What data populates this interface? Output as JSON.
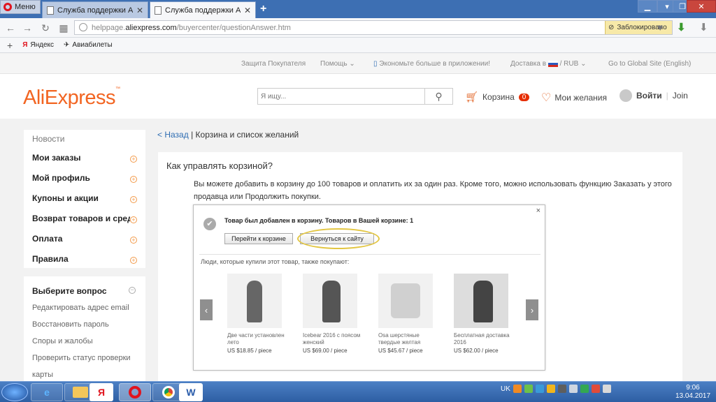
{
  "browser": {
    "menu_label": "Меню",
    "tabs": [
      {
        "title": "Служба поддержки AliExp"
      },
      {
        "title": "Служба поддержки AliExp"
      }
    ],
    "new_tab": "+",
    "url_prefix": "helppage.",
    "url_domain": "aliexpress.com",
    "url_path": "/buyercenter/questionAnswer.htm",
    "blocked_label": "Заблокировано",
    "bookmarks": [
      {
        "label": "Яндекс",
        "icon": "yandex-icon"
      },
      {
        "label": "Авиабилеты",
        "icon": "plane-icon"
      }
    ]
  },
  "site_top": {
    "buyer_protection": "Защита Покупателя",
    "help": "Помощь",
    "app_promo": "Экономьте больше в приложении!",
    "delivery": "Доставка в",
    "currency": "/ RUB",
    "global_site": "Go to Global Site (English)"
  },
  "header": {
    "logo": "AliExpress",
    "search_placeholder": "Я ищу...",
    "cart_label": "Корзина",
    "cart_count": "0",
    "wishlist_label": "Мои желания",
    "signin_label": "Войти",
    "join_label": "Join"
  },
  "sidebar": {
    "news": "Новости",
    "items": [
      {
        "label": "Мои заказы"
      },
      {
        "label": "Мой профиль"
      },
      {
        "label": "Купоны и акции"
      },
      {
        "label": "Возврат товаров и средств"
      },
      {
        "label": "Оплата"
      },
      {
        "label": "Правила"
      }
    ],
    "question_title": "Выберите вопрос",
    "questions": [
      {
        "label": "Редактировать адрес email"
      },
      {
        "label": "Восстановить пароль"
      },
      {
        "label": "Споры и жалобы"
      },
      {
        "label": "Проверить статус проверки"
      },
      {
        "label": "карты"
      }
    ]
  },
  "main": {
    "back_link": "< Назад",
    "breadcrumb_sep": "|",
    "breadcrumb_title": "Корзина и список желаний",
    "question": "Как управлять корзиной?",
    "answer": "Вы можете добавить в корзину до 100 товаров и оплатить их за один раз. Кроме того, можно использовать функцию Заказать у этого продавца или Продолжить покупки."
  },
  "popup": {
    "close": "×",
    "message": "Товар был добавлен в корзину. Товаров в Вашей корзине: 1",
    "go_to_cart": "Перейти к корзине",
    "back_to_site": "Вернуться к сайту",
    "also_buy": "Люди, которые купили этот товар, также покупают:",
    "products": [
      {
        "name": "Две части установлен лето",
        "price": "US $18.85 / piece"
      },
      {
        "name": "Icebear 2016 с поясом женский",
        "price": "US $69.00 / piece"
      },
      {
        "name": "Osa шерстяные твердые желтая",
        "price": "US $45.67 / piece"
      },
      {
        "name": "Бесплатная доставка 2016",
        "price": "US $62.00 / piece"
      }
    ]
  },
  "taskbar": {
    "lang": "UK",
    "time": "9:06",
    "date": "13.04.2017"
  }
}
